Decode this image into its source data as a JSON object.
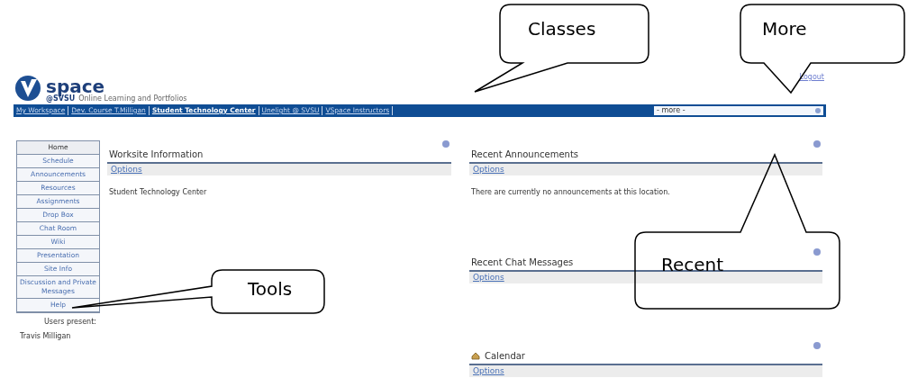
{
  "header": {
    "logo_text": "space",
    "logo_sub": "@SVSU",
    "tagline": "Online Learning and Portfolios",
    "logout": "Logout"
  },
  "site_tabs": [
    {
      "label": "My Workspace",
      "selected": false
    },
    {
      "label": "Dev. Course T.Milligan",
      "selected": false
    },
    {
      "label": "Student Technology Center",
      "selected": true
    },
    {
      "label": "Unelight @ SVSU",
      "selected": false
    },
    {
      "label": "VSpace Instructors",
      "selected": false
    }
  ],
  "more_select": {
    "value": "- more -"
  },
  "sidebar": {
    "items": [
      {
        "label": "Home",
        "selected": true
      },
      {
        "label": "Schedule",
        "selected": false
      },
      {
        "label": "Announcements",
        "selected": false
      },
      {
        "label": "Resources",
        "selected": false
      },
      {
        "label": "Assignments",
        "selected": false
      },
      {
        "label": "Drop Box",
        "selected": false
      },
      {
        "label": "Chat Room",
        "selected": false
      },
      {
        "label": "Wiki",
        "selected": false
      },
      {
        "label": "Presentation",
        "selected": false
      },
      {
        "label": "Site Info",
        "selected": false
      },
      {
        "label": "Discussion and Private Messages",
        "selected": false
      },
      {
        "label": "Help",
        "selected": false
      }
    ],
    "users_label": "Users present:",
    "users": [
      "Travis Milligan"
    ]
  },
  "left_portlets": [
    {
      "title": "Worksite Information",
      "options": "Options",
      "body": "Student Technology Center",
      "icon": false
    }
  ],
  "right_portlets": [
    {
      "title": "Recent Announcements",
      "options": "Options",
      "body": "There are currently no announcements at this location.",
      "icon": false
    },
    {
      "title": "Recent Chat Messages",
      "options": "Options",
      "icon": false
    },
    {
      "title": "Calendar",
      "options": "Options",
      "icon": true
    }
  ],
  "callouts": [
    {
      "kind": "classes",
      "text": "Classes"
    },
    {
      "kind": "more",
      "text": "More"
    },
    {
      "kind": "tools",
      "text": "Tools"
    },
    {
      "kind": "recent",
      "text": "Recent"
    }
  ]
}
